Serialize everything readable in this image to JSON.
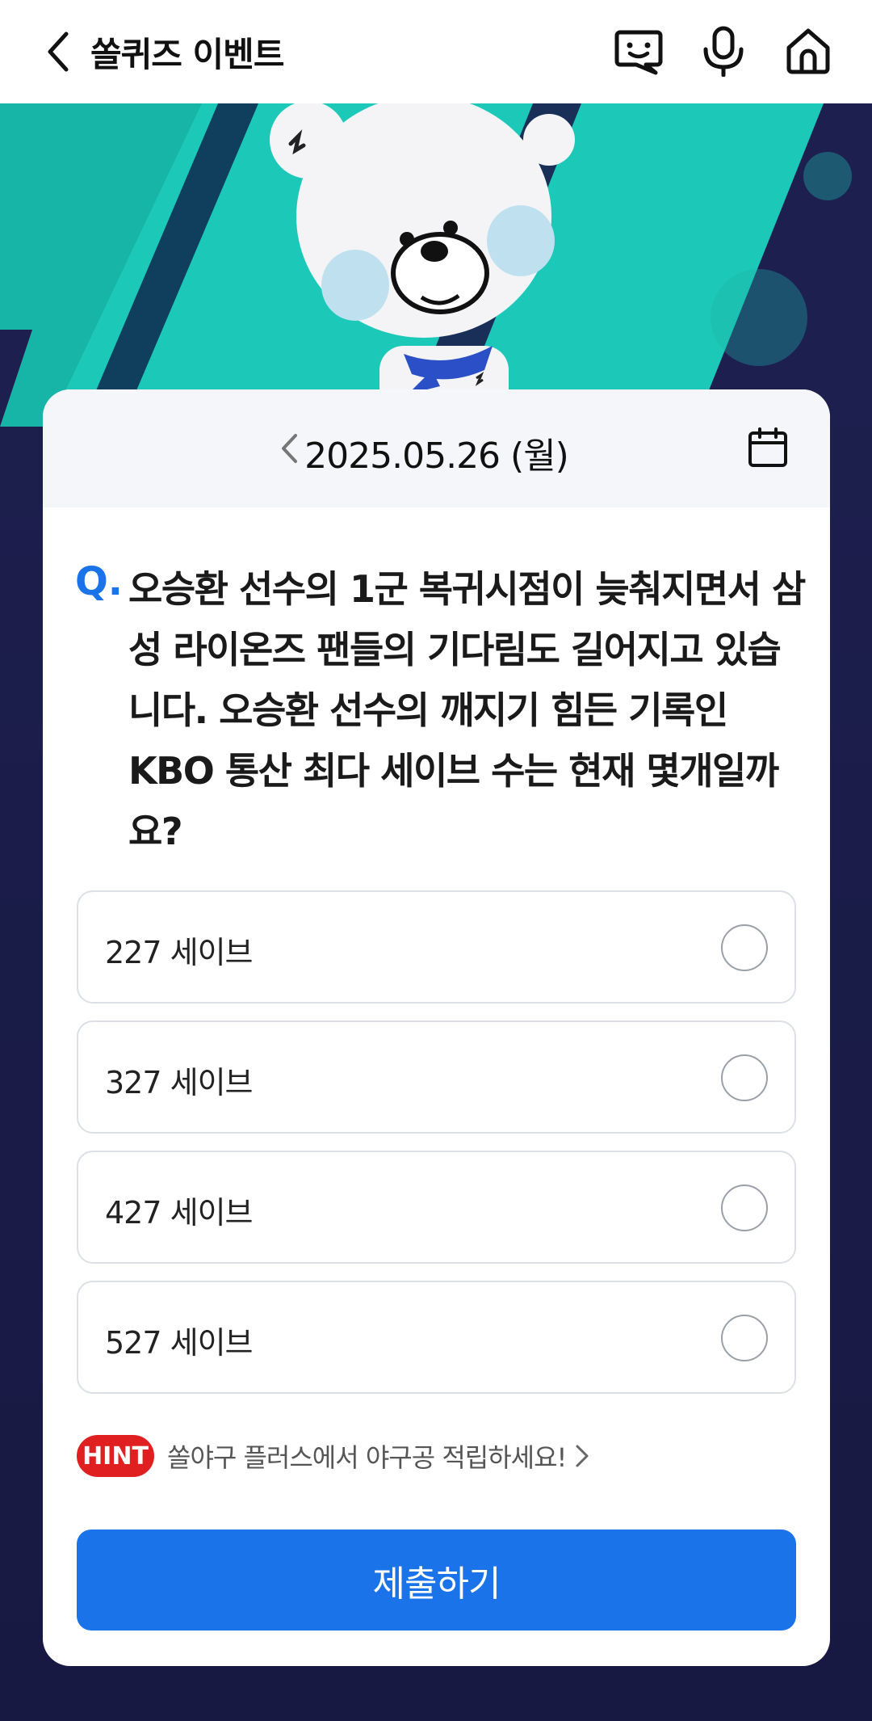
{
  "header": {
    "title": "쏠퀴즈 이벤트"
  },
  "date_bar": {
    "date": "2025.05.26 (월)"
  },
  "question": {
    "mark": "Q.",
    "text": "오승환 선수의 1군 복귀시점이 늦춰지면서 삼성 라이온즈 팬들의 기다림도 길어지고 있습니다. 오승환 선수의 깨지기 힘든 기록인 KBO 통산 최다 세이브 수는 현재 몇개일까요?"
  },
  "options": [
    {
      "label": "227 세이브"
    },
    {
      "label": "327 세이브"
    },
    {
      "label": "427 세이브"
    },
    {
      "label": "527 세이브"
    }
  ],
  "hint": {
    "badge": "HINT",
    "text": "쏠야구 플러스에서 야구공 적립하세요!"
  },
  "submit": {
    "label": "제출하기"
  },
  "colors": {
    "accent": "#1a73e8",
    "hint_badge": "#e02020",
    "background": "#1d1f4f",
    "banner_teal": "#1cc9b8"
  },
  "icons": {
    "back": "chevron-left-icon",
    "chat": "chat-face-icon",
    "mic": "microphone-icon",
    "home": "home-icon",
    "date_prev": "chevron-left-icon",
    "calendar": "calendar-icon",
    "hint_arrow": "chevron-right-icon"
  }
}
